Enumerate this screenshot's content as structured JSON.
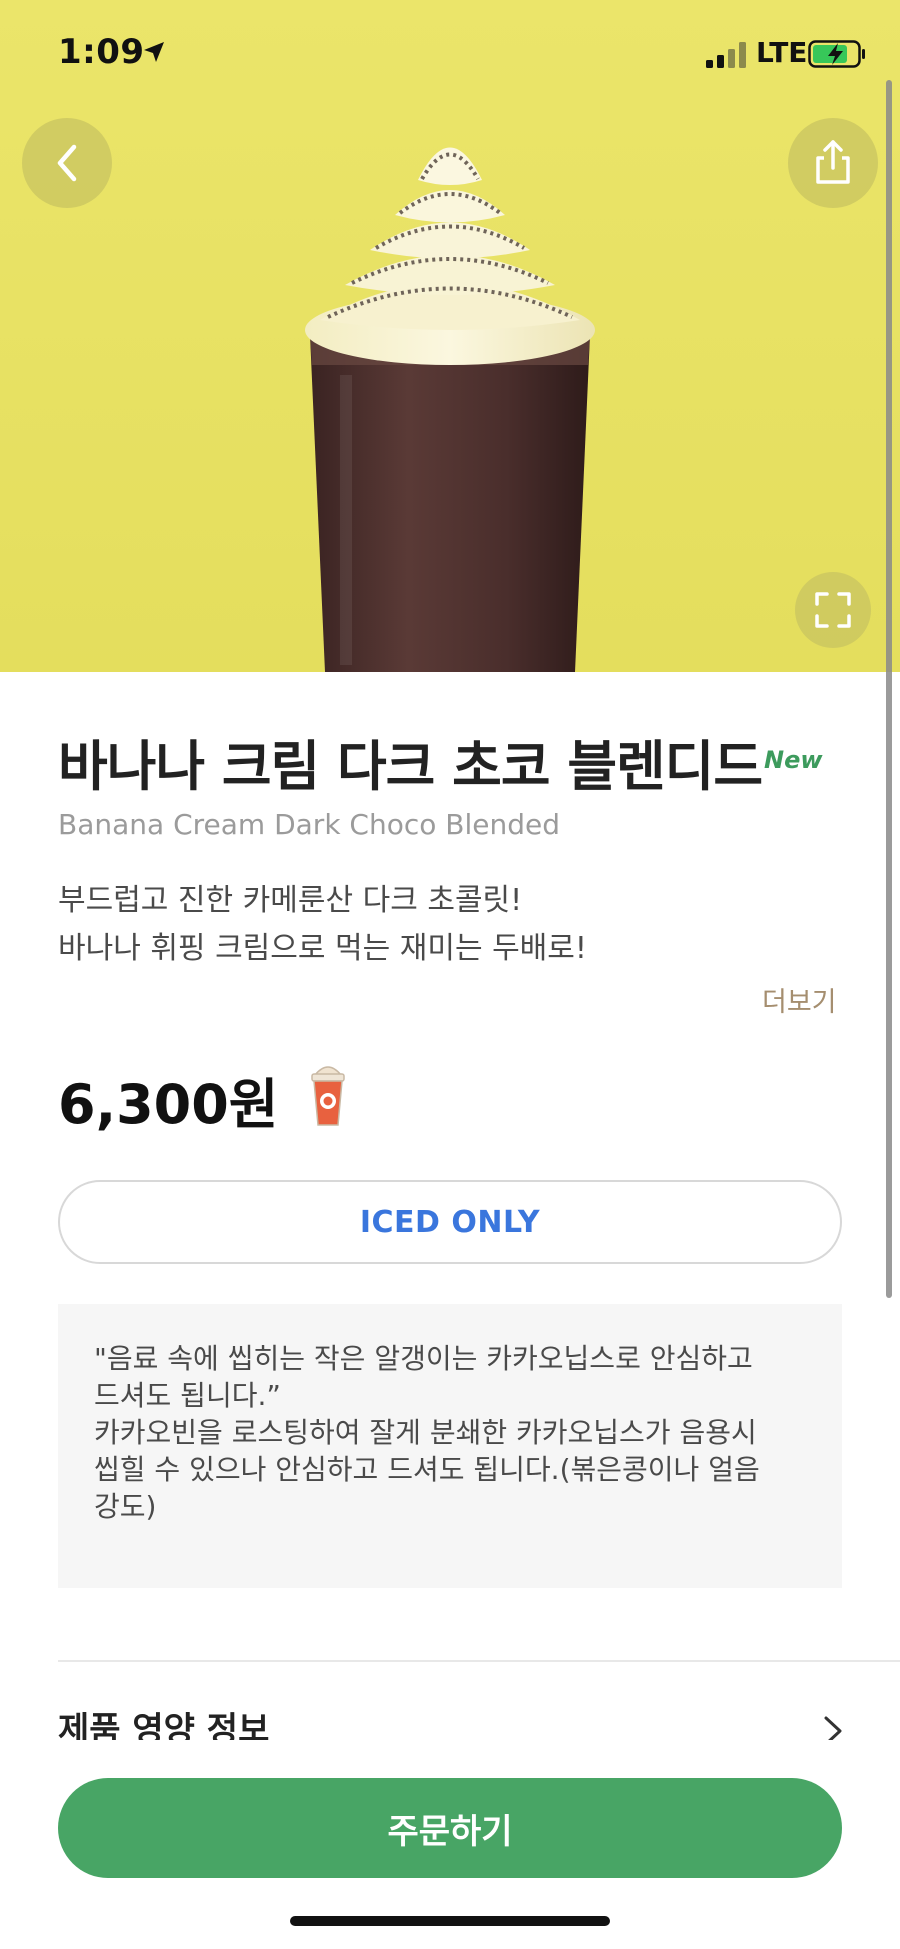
{
  "status_bar": {
    "time": "1:09",
    "network": "LTE"
  },
  "icons": {
    "back": "chevron-left-icon",
    "share": "share-icon",
    "expand": "expand-icon",
    "cup": "frappuccino-cup-icon",
    "chevron_right": "chevron-right-icon"
  },
  "colors": {
    "hero_background": "#e8e263",
    "accent_green": "#48a565",
    "iced_blue": "#3a76dd",
    "more_link_brown": "#a58e6f"
  },
  "product": {
    "name_ko": "바나나 크림 다크 초코 블렌디드",
    "badge": "New",
    "name_en": "Banana Cream Dark Choco Blended",
    "description": [
      "부드럽고 진한 카메룬산 다크 초콜릿!",
      "바나나 휘핑 크림으로 먹는 재미는 두배로!"
    ],
    "more_label": "더보기",
    "price": "6,300원",
    "temperature_label": "ICED ONLY"
  },
  "notice": {
    "lines": [
      "\"음료 속에 씹히는 작은 알갱이는 카카오닙스로 안심하고",
      "드셔도 됩니다.”",
      "카카오빈을 로스팅하여 잘게 분쇄한 카카오닙스가 음용시",
      "씹힐 수 있으나 안심하고 드셔도 됩니다.(볶은콩이나 얼음",
      "강도)"
    ]
  },
  "nutrition": {
    "label": "제품 영양 정보"
  },
  "order": {
    "label": "주문하기"
  }
}
